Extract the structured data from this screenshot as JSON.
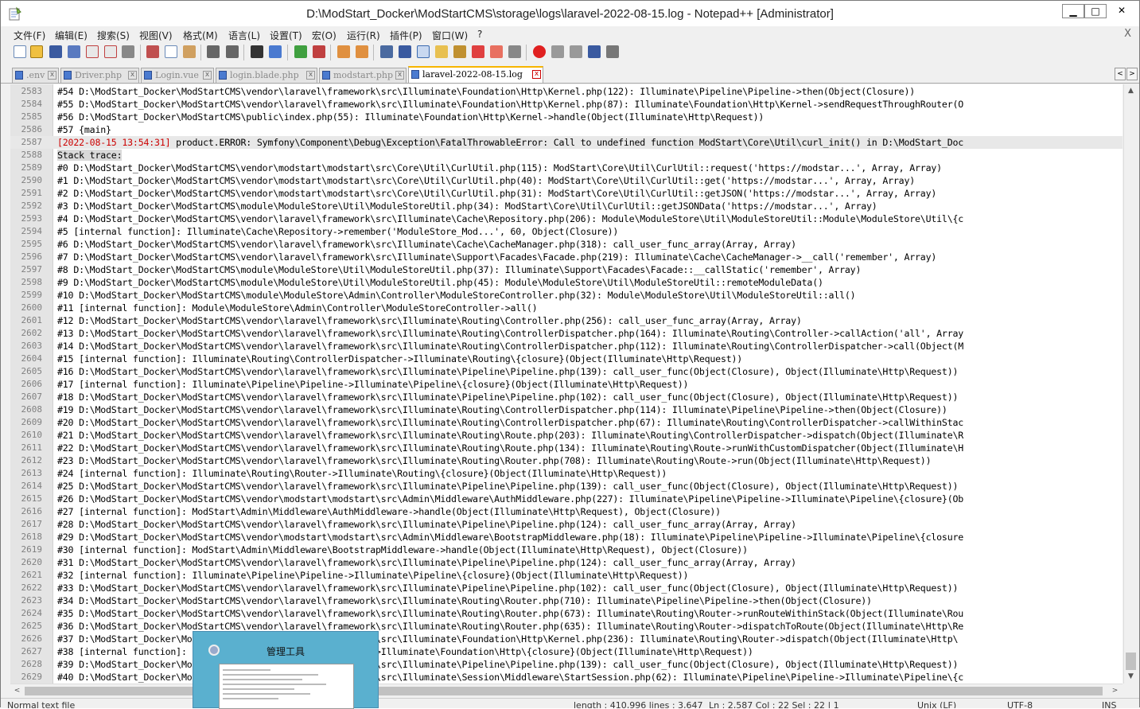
{
  "window": {
    "title": "D:\\ModStart_Docker\\ModStartCMS\\storage\\logs\\laravel-2022-08-15.log - Notepad++ [Administrator]",
    "minimize": "▁",
    "maximize": "□",
    "close": "✕"
  },
  "menu": {
    "items": [
      "文件(F)",
      "编辑(E)",
      "搜索(S)",
      "视图(V)",
      "格式(M)",
      "语言(L)",
      "设置(T)",
      "宏(O)",
      "运行(R)",
      "插件(P)",
      "窗口(W)",
      "?"
    ],
    "close_doc": "X"
  },
  "tabs": [
    {
      "label": ".env",
      "active": false
    },
    {
      "label": "Driver.php",
      "active": false
    },
    {
      "label": "Login.vue",
      "active": false
    },
    {
      "label": "login.blade.php",
      "active": false
    },
    {
      "label": "modstart.php",
      "active": false
    },
    {
      "label": "laravel-2022-08-15.log",
      "active": true
    }
  ],
  "tab_close": "x",
  "editor": {
    "lines": [
      {
        "n": "2583",
        "t": "#54 D:\\ModStart_Docker\\ModStartCMS\\vendor\\laravel\\framework\\src\\Illuminate\\Foundation\\Http\\Kernel.php(122): Illuminate\\Pipeline\\Pipeline->then(Object(Closure))"
      },
      {
        "n": "2584",
        "t": "#55 D:\\ModStart_Docker\\ModStartCMS\\vendor\\laravel\\framework\\src\\Illuminate\\Foundation\\Http\\Kernel.php(87): Illuminate\\Foundation\\Http\\Kernel->sendRequestThroughRouter(O"
      },
      {
        "n": "2585",
        "t": "#56 D:\\ModStart_Docker\\ModStartCMS\\public\\index.php(55): Illuminate\\Foundation\\Http\\Kernel->handle(Object(Illuminate\\Http\\Request))"
      },
      {
        "n": "2586",
        "t": "#57 {main}"
      },
      {
        "n": "2587",
        "timestamp": "[2022-08-15 13:54:31]",
        "t": " product.ERROR: Symfony\\Component\\Debug\\Exception\\FatalThrowableError: Call to undefined function ModStart\\Core\\Util\\curl_init() in D:\\ModStart_Doc"
      },
      {
        "n": "2588",
        "t": "Stack trace:"
      },
      {
        "n": "2589",
        "t": "#0 D:\\ModStart_Docker\\ModStartCMS\\vendor\\modstart\\modstart\\src\\Core\\Util\\CurlUtil.php(115): ModStart\\Core\\Util\\CurlUtil::request('https://modstar...', Array, Array)"
      },
      {
        "n": "2590",
        "t": "#1 D:\\ModStart_Docker\\ModStartCMS\\vendor\\modstart\\modstart\\src\\Core\\Util\\CurlUtil.php(40): ModStart\\Core\\Util\\CurlUtil::get('https://modstar...', Array, Array)"
      },
      {
        "n": "2591",
        "t": "#2 D:\\ModStart_Docker\\ModStartCMS\\vendor\\modstart\\modstart\\src\\Core\\Util\\CurlUtil.php(31): ModStart\\Core\\Util\\CurlUtil::getJSON('https://modstar...', Array, Array)"
      },
      {
        "n": "2592",
        "t": "#3 D:\\ModStart_Docker\\ModStartCMS\\module\\ModuleStore\\Util\\ModuleStoreUtil.php(34): ModStart\\Core\\Util\\CurlUtil::getJSONData('https://modstar...', Array)"
      },
      {
        "n": "2593",
        "t": "#4 D:\\ModStart_Docker\\ModStartCMS\\vendor\\laravel\\framework\\src\\Illuminate\\Cache\\Repository.php(206): Module\\ModuleStore\\Util\\ModuleStoreUtil::Module\\ModuleStore\\Util\\{c"
      },
      {
        "n": "2594",
        "t": "#5 [internal function]: Illuminate\\Cache\\Repository->remember('ModuleStore_Mod...', 60, Object(Closure))"
      },
      {
        "n": "2595",
        "t": "#6 D:\\ModStart_Docker\\ModStartCMS\\vendor\\laravel\\framework\\src\\Illuminate\\Cache\\CacheManager.php(318): call_user_func_array(Array, Array)"
      },
      {
        "n": "2596",
        "t": "#7 D:\\ModStart_Docker\\ModStartCMS\\vendor\\laravel\\framework\\src\\Illuminate\\Support\\Facades\\Facade.php(219): Illuminate\\Cache\\CacheManager->__call('remember', Array)"
      },
      {
        "n": "2597",
        "t": "#8 D:\\ModStart_Docker\\ModStartCMS\\module\\ModuleStore\\Util\\ModuleStoreUtil.php(37): Illuminate\\Support\\Facades\\Facade::__callStatic('remember', Array)"
      },
      {
        "n": "2598",
        "t": "#9 D:\\ModStart_Docker\\ModStartCMS\\module\\ModuleStore\\Util\\ModuleStoreUtil.php(45): Module\\ModuleStore\\Util\\ModuleStoreUtil::remoteModuleData()"
      },
      {
        "n": "2599",
        "t": "#10 D:\\ModStart_Docker\\ModStartCMS\\module\\ModuleStore\\Admin\\Controller\\ModuleStoreController.php(32): Module\\ModuleStore\\Util\\ModuleStoreUtil::all()"
      },
      {
        "n": "2600",
        "t": "#11 [internal function]: Module\\ModuleStore\\Admin\\Controller\\ModuleStoreController->all()"
      },
      {
        "n": "2601",
        "t": "#12 D:\\ModStart_Docker\\ModStartCMS\\vendor\\laravel\\framework\\src\\Illuminate\\Routing\\Controller.php(256): call_user_func_array(Array, Array)"
      },
      {
        "n": "2602",
        "t": "#13 D:\\ModStart_Docker\\ModStartCMS\\vendor\\laravel\\framework\\src\\Illuminate\\Routing\\ControllerDispatcher.php(164): Illuminate\\Routing\\Controller->callAction('all', Array"
      },
      {
        "n": "2603",
        "t": "#14 D:\\ModStart_Docker\\ModStartCMS\\vendor\\laravel\\framework\\src\\Illuminate\\Routing\\ControllerDispatcher.php(112): Illuminate\\Routing\\ControllerDispatcher->call(Object(M"
      },
      {
        "n": "2604",
        "t": "#15 [internal function]: Illuminate\\Routing\\ControllerDispatcher->Illuminate\\Routing\\{closure}(Object(Illuminate\\Http\\Request))"
      },
      {
        "n": "2605",
        "t": "#16 D:\\ModStart_Docker\\ModStartCMS\\vendor\\laravel\\framework\\src\\Illuminate\\Pipeline\\Pipeline.php(139): call_user_func(Object(Closure), Object(Illuminate\\Http\\Request))"
      },
      {
        "n": "2606",
        "t": "#17 [internal function]: Illuminate\\Pipeline\\Pipeline->Illuminate\\Pipeline\\{closure}(Object(Illuminate\\Http\\Request))"
      },
      {
        "n": "2607",
        "t": "#18 D:\\ModStart_Docker\\ModStartCMS\\vendor\\laravel\\framework\\src\\Illuminate\\Pipeline\\Pipeline.php(102): call_user_func(Object(Closure), Object(Illuminate\\Http\\Request))"
      },
      {
        "n": "2608",
        "t": "#19 D:\\ModStart_Docker\\ModStartCMS\\vendor\\laravel\\framework\\src\\Illuminate\\Routing\\ControllerDispatcher.php(114): Illuminate\\Pipeline\\Pipeline->then(Object(Closure))"
      },
      {
        "n": "2609",
        "t": "#20 D:\\ModStart_Docker\\ModStartCMS\\vendor\\laravel\\framework\\src\\Illuminate\\Routing\\ControllerDispatcher.php(67): Illuminate\\Routing\\ControllerDispatcher->callWithinStac"
      },
      {
        "n": "2610",
        "t": "#21 D:\\ModStart_Docker\\ModStartCMS\\vendor\\laravel\\framework\\src\\Illuminate\\Routing\\Route.php(203): Illuminate\\Routing\\ControllerDispatcher->dispatch(Object(Illuminate\\R"
      },
      {
        "n": "2611",
        "t": "#22 D:\\ModStart_Docker\\ModStartCMS\\vendor\\laravel\\framework\\src\\Illuminate\\Routing\\Route.php(134): Illuminate\\Routing\\Route->runWithCustomDispatcher(Object(Illuminate\\H"
      },
      {
        "n": "2612",
        "t": "#23 D:\\ModStart_Docker\\ModStartCMS\\vendor\\laravel\\framework\\src\\Illuminate\\Routing\\Router.php(708): Illuminate\\Routing\\Route->run(Object(Illuminate\\Http\\Request))"
      },
      {
        "n": "2613",
        "t": "#24 [internal function]: Illuminate\\Routing\\Router->Illuminate\\Routing\\{closure}(Object(Illuminate\\Http\\Request))"
      },
      {
        "n": "2614",
        "t": "#25 D:\\ModStart_Docker\\ModStartCMS\\vendor\\laravel\\framework\\src\\Illuminate\\Pipeline\\Pipeline.php(139): call_user_func(Object(Closure), Object(Illuminate\\Http\\Request))"
      },
      {
        "n": "2615",
        "t": "#26 D:\\ModStart_Docker\\ModStartCMS\\vendor\\modstart\\modstart\\src\\Admin\\Middleware\\AuthMiddleware.php(227): Illuminate\\Pipeline\\Pipeline->Illuminate\\Pipeline\\{closure}(Ob"
      },
      {
        "n": "2616",
        "t": "#27 [internal function]: ModStart\\Admin\\Middleware\\AuthMiddleware->handle(Object(Illuminate\\Http\\Request), Object(Closure))"
      },
      {
        "n": "2617",
        "t": "#28 D:\\ModStart_Docker\\ModStartCMS\\vendor\\laravel\\framework\\src\\Illuminate\\Pipeline\\Pipeline.php(124): call_user_func_array(Array, Array)"
      },
      {
        "n": "2618",
        "t": "#29 D:\\ModStart_Docker\\ModStartCMS\\vendor\\modstart\\modstart\\src\\Admin\\Middleware\\BootstrapMiddleware.php(18): Illuminate\\Pipeline\\Pipeline->Illuminate\\Pipeline\\{closure"
      },
      {
        "n": "2619",
        "t": "#30 [internal function]: ModStart\\Admin\\Middleware\\BootstrapMiddleware->handle(Object(Illuminate\\Http\\Request), Object(Closure))"
      },
      {
        "n": "2620",
        "t": "#31 D:\\ModStart_Docker\\ModStartCMS\\vendor\\laravel\\framework\\src\\Illuminate\\Pipeline\\Pipeline.php(124): call_user_func_array(Array, Array)"
      },
      {
        "n": "2621",
        "t": "#32 [internal function]: Illuminate\\Pipeline\\Pipeline->Illuminate\\Pipeline\\{closure}(Object(Illuminate\\Http\\Request))"
      },
      {
        "n": "2622",
        "t": "#33 D:\\ModStart_Docker\\ModStartCMS\\vendor\\laravel\\framework\\src\\Illuminate\\Pipeline\\Pipeline.php(102): call_user_func(Object(Closure), Object(Illuminate\\Http\\Request))"
      },
      {
        "n": "2623",
        "t": "#34 D:\\ModStart_Docker\\ModStartCMS\\vendor\\laravel\\framework\\src\\Illuminate\\Routing\\Router.php(710): Illuminate\\Pipeline\\Pipeline->then(Object(Closure))"
      },
      {
        "n": "2624",
        "t": "#35 D:\\ModStart_Docker\\ModStartCMS\\vendor\\laravel\\framework\\src\\Illuminate\\Routing\\Router.php(673): Illuminate\\Routing\\Router->runRouteWithinStack(Object(Illuminate\\Rou"
      },
      {
        "n": "2625",
        "t": "#36 D:\\ModStart_Docker\\ModStartCMS\\vendor\\laravel\\framework\\src\\Illuminate\\Routing\\Router.php(635): Illuminate\\Routing\\Router->dispatchToRoute(Object(Illuminate\\Http\\Re"
      },
      {
        "n": "2626",
        "t": "#37 D:\\ModStart_Docker\\ModStartCMS\\vendor\\laravel\\framework\\src\\Illuminate\\Foundation\\Http\\Kernel.php(236): Illuminate\\Routing\\Router->dispatch(Object(Illuminate\\Http\\"
      },
      {
        "n": "2627",
        "t": "#38 [internal function]: Illuminate\\Foundation\\Http\\Kernel->Illuminate\\Foundation\\Http\\{closure}(Object(Illuminate\\Http\\Request))"
      },
      {
        "n": "2628",
        "t": "#39 D:\\ModStart_Docker\\ModStartCMS\\vendor\\laravel\\framework\\src\\Illuminate\\Pipeline\\Pipeline.php(139): call_user_func(Object(Closure), Object(Illuminate\\Http\\Request))"
      },
      {
        "n": "2629",
        "t": "#40 D:\\ModStart_Docker\\ModStartCMS\\vendor\\laravel\\framework\\src\\Illuminate\\Session\\Middleware\\StartSession.php(62): Illuminate\\Pipeline\\Pipeline->Illuminate\\Pipeline\\{c"
      }
    ]
  },
  "scroll": {
    "up": "▲",
    "down": "▼",
    "left": "<",
    "right": ">"
  },
  "popup": {
    "title": "管理工具"
  },
  "status": {
    "type": "Normal text file",
    "length": "length : 410,996    lines : 3,647",
    "position": "Ln : 2,587    Col : 22    Sel : 22 | 1",
    "eol": "Unix (LF)",
    "encoding": "UTF-8",
    "mode": "INS"
  },
  "colors": {
    "accent": "#f7b500",
    "error_timestamp": "#cc0000",
    "gutter": "#e4e4e4"
  }
}
